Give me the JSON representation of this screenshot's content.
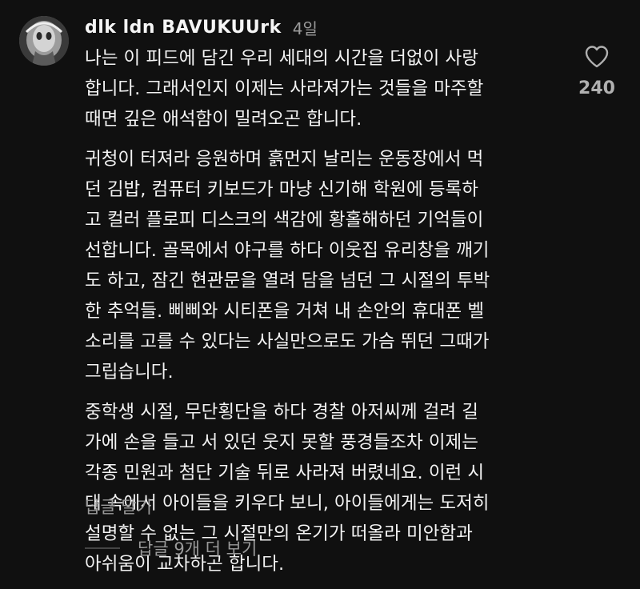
{
  "comment": {
    "username": "dlk ldn BAVUKUUrk",
    "time": "4일",
    "paragraphs": [
      {
        "lines": [
          "나는 이 피드에 담긴 우리 세대의 시간을 더없이 사랑",
          "합니다. 그래서인지 이제는 사라져가는 것들을 마주할",
          "때면 깊은 애석함이 밀려오곤 합니다."
        ]
      },
      {
        "lines": [
          "귀청이 터져라 응원하며 흙먼지 날리는 운동장에서 먹",
          "던 김밥, 컴퓨터 키보드가 마냥 신기해 학원에 등록하",
          "고 컬러 플로피 디스크의 색감에 황홀해하던 기억들이",
          "선합니다. 골목에서 야구를 하다 이웃집 유리창을 깨기",
          "도 하고, 잠긴 현관문을 열려 담을 넘던 그 시절의 투박",
          "한 추억들. 삐삐와 시티폰을 거쳐 내 손안의 휴대폰 벨",
          "소리를 고를 수 있다는 사실만으로도 가슴 뛰던 그때가",
          "그립습니다."
        ]
      },
      {
        "lines": [
          "중학생 시절, 무단횡단을 하다 경찰 아저씨께 걸려 길",
          "가에 손을 들고 서 있던 웃지 못할 풍경들조차 이제는",
          "각종 민원과 첨단 기술 뒤로 사라져 버렸네요. 이런 시",
          "대 속에서 아이들을 키우다 보니, 아이들에게는 도저히",
          "설명할 수 없는 그 시절만의 온기가 떠올라 미안함과",
          "아쉬움이 교차하곤 합니다."
        ]
      }
    ],
    "like_icon": "heart-outline-icon",
    "like_count": "240",
    "reply_label": "답글 달기",
    "more_replies_label": "답글 9개 더 보기"
  },
  "colors": {
    "background": "#101010",
    "text": "#f3f3f3",
    "muted": "#9a9a9a"
  }
}
